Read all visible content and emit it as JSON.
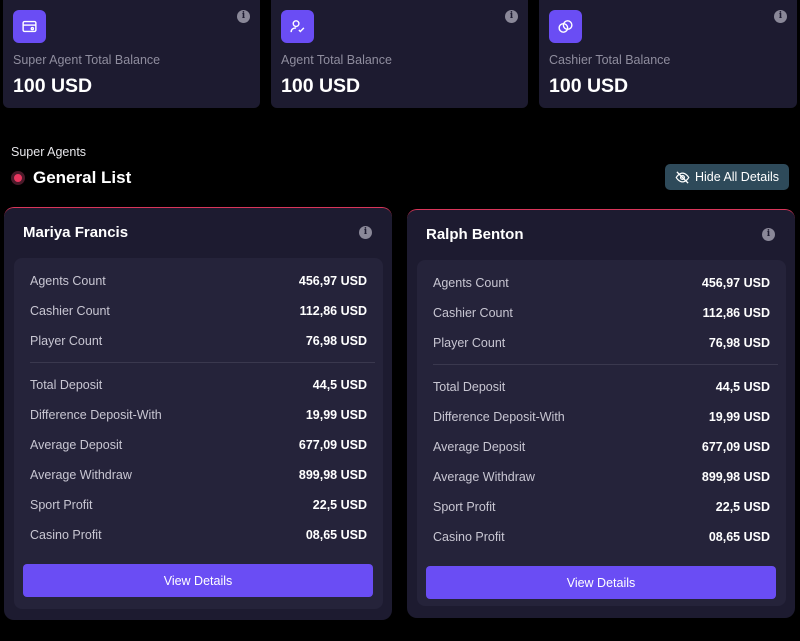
{
  "colors": {
    "background": "#000000",
    "card": "#1d1b30",
    "accent": "#6a4df4",
    "danger_dot": "#e8365f",
    "hide_button": "#2e4a5a"
  },
  "balances": [
    {
      "label": "Super Agent Total Balance",
      "value": "100 USD",
      "icon": "wallet-card-icon"
    },
    {
      "label": "Agent Total Balance",
      "value": "100 USD",
      "icon": "user-check-icon"
    },
    {
      "label": "Cashier Total Balance",
      "value": "100 USD",
      "icon": "coins-icon"
    }
  ],
  "section": {
    "label": "Super Agents",
    "title": "General List"
  },
  "hide_button": {
    "label": "Hide All Details",
    "icon": "eye-off-icon"
  },
  "agents": [
    {
      "name": "Mariya Francis",
      "stats": [
        {
          "label": "Agents Count",
          "value": "456,97 USD"
        },
        {
          "label": "Cashier Count",
          "value": "112,86 USD"
        },
        {
          "label": "Player Count",
          "value": "76,98 USD"
        },
        {
          "label": "Total Deposit",
          "value": "44,5 USD"
        },
        {
          "label": "Difference Deposit-With",
          "value": "19,99 USD"
        },
        {
          "label": "Average Deposit",
          "value": "677,09 USD"
        },
        {
          "label": "Average Withdraw",
          "value": "899,98 USD"
        },
        {
          "label": "Sport Profit",
          "value": "22,5 USD"
        },
        {
          "label": "Casino Profit",
          "value": "08,65 USD"
        }
      ],
      "button": "View Details"
    },
    {
      "name": "Ralph Benton",
      "stats": [
        {
          "label": "Agents Count",
          "value": "456,97 USD"
        },
        {
          "label": "Cashier Count",
          "value": "112,86 USD"
        },
        {
          "label": "Player Count",
          "value": "76,98 USD"
        },
        {
          "label": "Total Deposit",
          "value": "44,5 USD"
        },
        {
          "label": "Difference Deposit-With",
          "value": "19,99 USD"
        },
        {
          "label": "Average Deposit",
          "value": "677,09 USD"
        },
        {
          "label": "Average Withdraw",
          "value": "899,98 USD"
        },
        {
          "label": "Sport Profit",
          "value": "22,5 USD"
        },
        {
          "label": "Casino Profit",
          "value": "08,65 USD"
        }
      ],
      "button": "View Details"
    }
  ]
}
